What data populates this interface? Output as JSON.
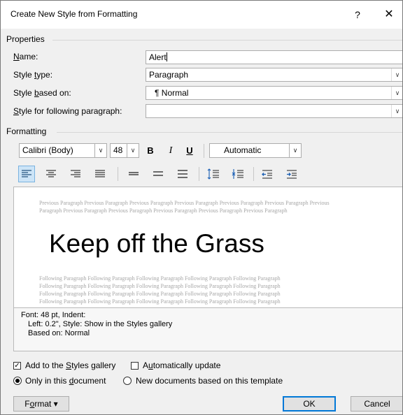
{
  "window": {
    "title": "Create New Style from Formatting",
    "help": "?",
    "close": "✕"
  },
  "properties": {
    "group_label": "Properties",
    "name_label": "Name:",
    "name_value": "Alert",
    "type_label": "Style type:",
    "type_value": "Paragraph",
    "based_label": "Style based on:",
    "based_value": "¶  Normal",
    "following_label": "Style for following paragraph:",
    "following_value": ""
  },
  "formatting": {
    "group_label": "Formatting",
    "font": "Calibri (Body)",
    "size": "48",
    "bold": "B",
    "italic": "I",
    "underline": "U",
    "color": "Automatic"
  },
  "preview": {
    "previous_lines": [
      "Previous Paragraph Previous Paragraph Previous Paragraph Previous Paragraph Previous Paragraph Previous Paragraph Previous",
      "Paragraph Previous Paragraph Previous Paragraph Previous Paragraph Previous Paragraph Previous Paragraph"
    ],
    "sample": "Keep off the Grass",
    "following_lines": [
      "Following Paragraph Following Paragraph Following Paragraph Following Paragraph Following Paragraph",
      "Following Paragraph Following Paragraph Following Paragraph Following Paragraph Following Paragraph",
      "Following Paragraph Following Paragraph Following Paragraph Following Paragraph Following Paragraph",
      "Following Paragraph Following Paragraph Following Paragraph Following Paragraph Following Paragraph"
    ]
  },
  "description": {
    "line1": "Font: 48 pt, Indent:",
    "line2": "Left:  0.2\", Style: Show in the Styles gallery",
    "line3": "Based on: Normal"
  },
  "options": {
    "add_to_gallery": "Add to the Styles gallery",
    "auto_update": "Automatically update",
    "only_this_doc": "Only in this document",
    "new_docs": "New documents based on this template"
  },
  "buttons": {
    "format": "Format",
    "ok": "OK",
    "cancel": "Cancel"
  },
  "colors": {
    "selected_align_bg": "#cce4f7",
    "ok_border": "#0078d7"
  }
}
